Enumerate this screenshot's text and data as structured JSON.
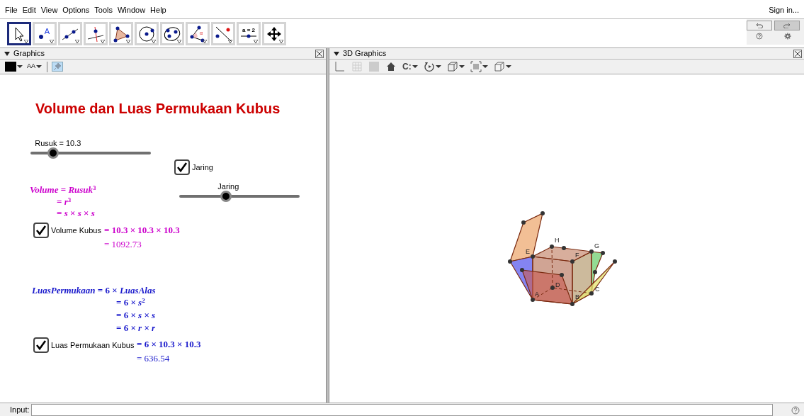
{
  "menu": [
    "File",
    "Edit",
    "View",
    "Options",
    "Tools",
    "Window",
    "Help"
  ],
  "sign_in": "Sign in...",
  "tools": [
    {
      "kind": "move",
      "selected": true
    },
    {
      "kind": "point",
      "label": "A",
      "selected": false
    },
    {
      "kind": "line",
      "selected": false
    },
    {
      "kind": "perpendicular",
      "selected": false
    },
    {
      "kind": "polygon",
      "selected": false
    },
    {
      "kind": "circle",
      "selected": false
    },
    {
      "kind": "conic",
      "selected": false
    },
    {
      "kind": "angle",
      "label": "α",
      "selected": false
    },
    {
      "kind": "reflect",
      "selected": false
    },
    {
      "kind": "slider",
      "label": "a = 2",
      "selected": false
    },
    {
      "kind": "move-view",
      "selected": false
    }
  ],
  "graphics": {
    "title": "Graphics",
    "style_bar": [
      {
        "kind": "color"
      },
      {
        "kind": "text-size",
        "label": "AA"
      },
      {
        "kind": "pin",
        "selected": true
      }
    ],
    "objects": [
      {
        "kind": "title",
        "text": "Volume dan Luas Permukaan Kubus"
      },
      {
        "kind": "slider",
        "label": "Rusuk = 10.3",
        "level": 0.19
      },
      {
        "kind": "checkbox",
        "label": "Jaring",
        "checked": true
      },
      {
        "kind": "slider",
        "label": "Jaring",
        "level": 0.39
      },
      {
        "kind": "formula",
        "color": "#cc00cc",
        "lines": [
          {
            "text": "*Volume* = *Rusuk*$^{3}$",
            "bold": true
          },
          {
            "text": "= *r*$^{3}$",
            "bold": true
          },
          {
            "text": "= *s* × *s* × *s*",
            "bold": true
          }
        ]
      },
      {
        "kind": "checkbox",
        "label": "Volume Kubus",
        "checked": true
      },
      {
        "kind": "formula",
        "color": "#cc00cc",
        "lines": [
          {
            "text": "= 10.3 × 10.3 × 10.3",
            "bold": true
          },
          {
            "text": "= 1092.73",
            "bold": false
          }
        ]
      },
      {
        "kind": "formula",
        "color": "#1a1acc",
        "lines": [
          {
            "text": "*LuasPermukaan* = 6 × *LuasAlas*",
            "bold": true
          },
          {
            "text": "= 6 × *s*$^{2}$",
            "bold": true
          },
          {
            "text": "= 6 × *s* × *s*",
            "bold": true
          },
          {
            "text": "= 6 × *r* × *r*",
            "bold": true
          }
        ]
      },
      {
        "kind": "checkbox",
        "label": "Luas Permukaan Kubus",
        "checked": true
      },
      {
        "kind": "formula",
        "color": "#1a1acc",
        "lines": [
          {
            "text": "= 6 × 10.3 × 10.3",
            "bold": true
          },
          {
            "text": "= 636.54",
            "bold": false
          }
        ]
      }
    ]
  },
  "graphics_3d": {
    "title": "3D Graphics",
    "style_bar": [
      {
        "kind": "axes"
      },
      {
        "kind": "grid"
      },
      {
        "kind": "plane"
      },
      {
        "kind": "home"
      },
      {
        "kind": "clip",
        "label": "C:"
      },
      {
        "kind": "rotate"
      },
      {
        "kind": "view"
      },
      {
        "kind": "points"
      },
      {
        "kind": "projection"
      }
    ],
    "points": [
      {
        "label": "H"
      },
      {
        "label": "G"
      },
      {
        "label": "E"
      },
      {
        "label": "F"
      },
      {
        "label": "D"
      },
      {
        "label": "A"
      },
      {
        "label": "B"
      },
      {
        "label": "C"
      }
    ]
  },
  "input_bar": {
    "label": "Input:"
  }
}
